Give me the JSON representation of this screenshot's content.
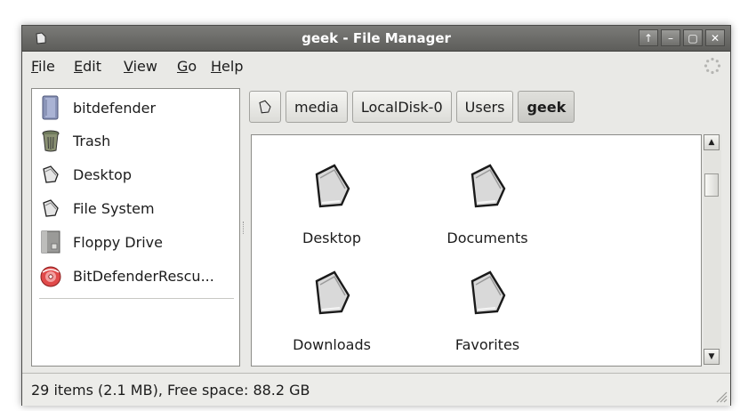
{
  "window": {
    "title": "geek - File Manager",
    "controls": [
      "up-arrow-icon",
      "minimize-icon",
      "maximize-icon",
      "close-icon"
    ]
  },
  "menubar": {
    "items": [
      {
        "label": "File",
        "mnemonic": "F",
        "rest": "ile"
      },
      {
        "label": "Edit",
        "mnemonic": "E",
        "rest": "dit"
      },
      {
        "label": "View",
        "mnemonic": "V",
        "rest": "iew"
      },
      {
        "label": "Go",
        "mnemonic": "G",
        "rest": "o"
      },
      {
        "label": "Help",
        "mnemonic": "H",
        "rest": "elp"
      }
    ]
  },
  "sidebar": {
    "items": [
      {
        "label": "bitdefender",
        "icon": "drive-icon"
      },
      {
        "label": "Trash",
        "icon": "trash-icon"
      },
      {
        "label": "Desktop",
        "icon": "folder-icon"
      },
      {
        "label": "File System",
        "icon": "folder-icon"
      },
      {
        "label": "Floppy Drive",
        "icon": "floppy-icon"
      },
      {
        "label": "BitDefenderRescu...",
        "icon": "cdrom-icon"
      }
    ]
  },
  "pathbar": {
    "buttons": [
      "media",
      "LocalDisk-0",
      "Users",
      "geek"
    ],
    "active": "geek"
  },
  "content": {
    "folders": [
      {
        "label": "Desktop"
      },
      {
        "label": "Documents"
      },
      {
        "label": "Downloads"
      },
      {
        "label": "Favorites"
      }
    ]
  },
  "status": {
    "text": "29 items (2.1 MB), Free space: 88.2 GB"
  },
  "colors": {
    "titlebar": "#6b6b68",
    "window_bg": "#e9e9e6",
    "content_bg": "#ffffff"
  }
}
